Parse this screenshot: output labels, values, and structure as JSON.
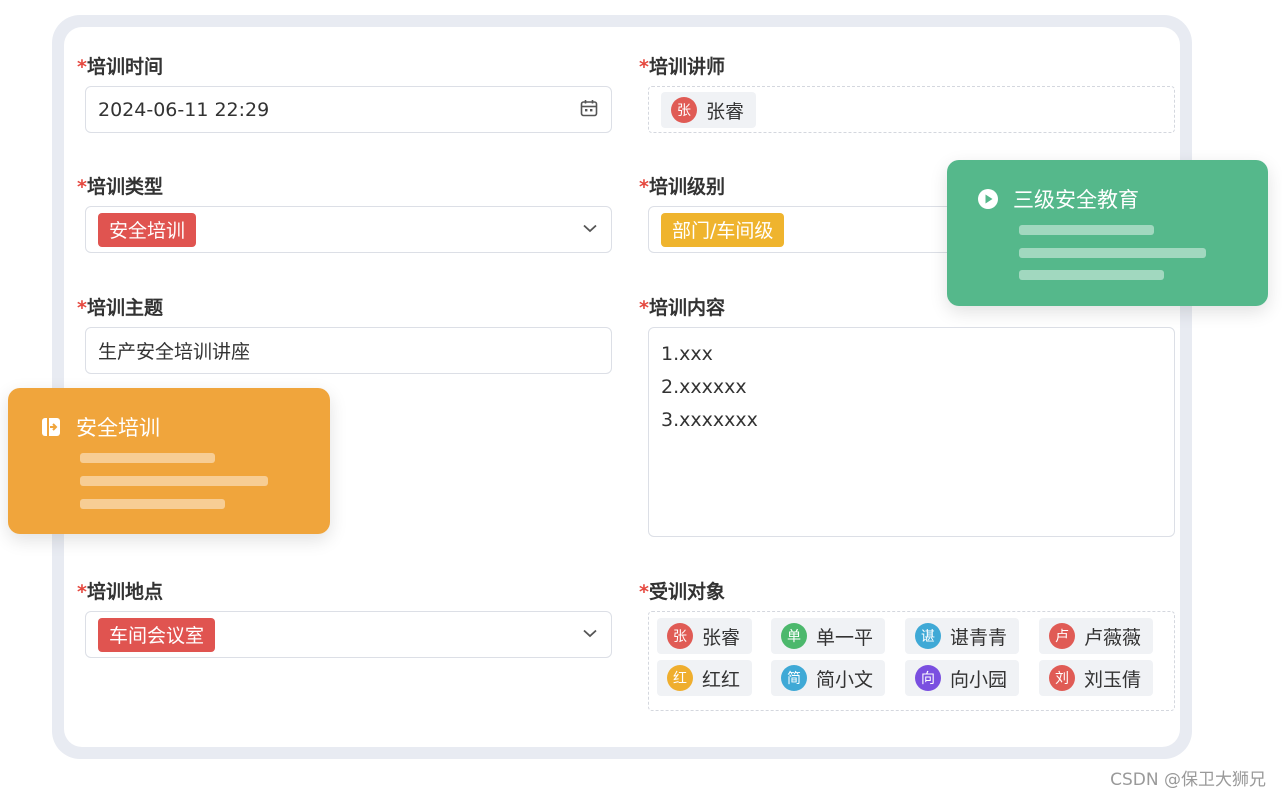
{
  "form": {
    "training_time": {
      "label": "培训时间",
      "required_mark": "*",
      "value": "2024-06-11 22:29",
      "icon": "calendar-icon"
    },
    "trainer": {
      "label": "培训讲师",
      "required_mark": "*",
      "person": {
        "avatar": "张",
        "name": "张睿",
        "color": "#e05b55"
      }
    },
    "training_type": {
      "label": "培训类型",
      "required_mark": "*",
      "value": "安全培训",
      "tag_color": "#e05450"
    },
    "training_level": {
      "label": "培训级别",
      "required_mark": "*",
      "value": "部门/车间级",
      "tag_color": "#efb42e"
    },
    "topic": {
      "label": "培训主题",
      "required_mark": "*",
      "value": "生产安全培训讲座"
    },
    "content": {
      "label": "培训内容",
      "required_mark": "*",
      "lines": [
        "1.xxx",
        "2.xxxxxx",
        "3.xxxxxxx"
      ]
    },
    "location": {
      "label": "培训地点",
      "required_mark": "*",
      "value": "车间会议室",
      "tag_color": "#e05450"
    },
    "trainees": {
      "label": "受训对象",
      "required_mark": "*",
      "people": [
        {
          "avatar": "张",
          "name": "张睿",
          "color": "#e05b55"
        },
        {
          "avatar": "单",
          "name": "单一平",
          "color": "#4cb86c"
        },
        {
          "avatar": "谌",
          "name": "谌青青",
          "color": "#3fa9d6"
        },
        {
          "avatar": "卢",
          "name": "卢薇薇",
          "color": "#e05b55"
        },
        {
          "avatar": "红",
          "name": "红红",
          "color": "#efae2e"
        },
        {
          "avatar": "简",
          "name": "简小文",
          "color": "#3fa9d6"
        },
        {
          "avatar": "向",
          "name": "向小园",
          "color": "#7a4fe0"
        },
        {
          "avatar": "刘",
          "name": "刘玉倩",
          "color": "#e05b55"
        }
      ]
    }
  },
  "float_cards": {
    "green": {
      "title": "三级安全教育",
      "icon": "play-circle-icon",
      "color": "#55b88b"
    },
    "orange": {
      "title": "安全培训",
      "icon": "login-icon",
      "color": "#f0a53c"
    }
  },
  "watermark": "CSDN @保卫大狮兄"
}
